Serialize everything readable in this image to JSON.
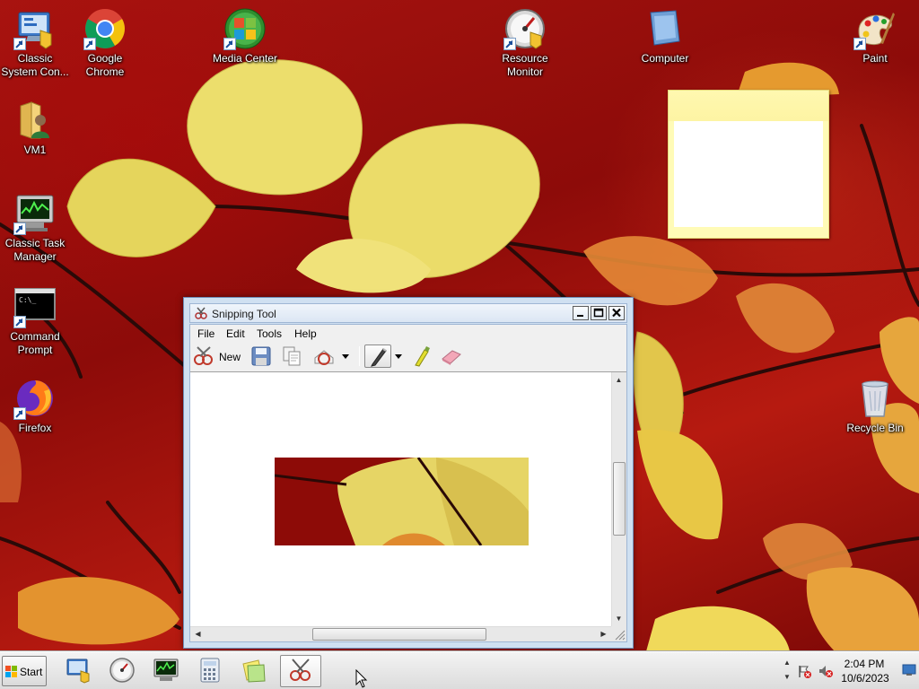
{
  "desktop": {
    "icons": [
      {
        "label": "Classic System Con...",
        "icon": "control-panel-icon"
      },
      {
        "label": "Google Chrome",
        "icon": "chrome-icon"
      },
      {
        "label": "Media Center",
        "icon": "media-center-icon"
      },
      {
        "label": "Resource Monitor",
        "icon": "resource-monitor-icon"
      },
      {
        "label": "Computer",
        "icon": "computer-icon"
      },
      {
        "label": "Paint",
        "icon": "paint-icon"
      },
      {
        "label": "VM1",
        "icon": "user-folder-icon"
      },
      {
        "label": "Classic Task Manager",
        "icon": "task-manager-icon"
      },
      {
        "label": "Command Prompt",
        "icon": "command-prompt-icon"
      },
      {
        "label": "Firefox",
        "icon": "firefox-icon"
      },
      {
        "label": "Recycle Bin",
        "icon": "recycle-bin-icon"
      }
    ]
  },
  "snipping_tool": {
    "title": "Snipping Tool",
    "menu": [
      "File",
      "Edit",
      "Tools",
      "Help"
    ],
    "toolbar": {
      "new_label": "New",
      "buttons": [
        "new-snip-icon",
        "save-icon",
        "copy-icon",
        "send-snip-icon",
        "pen-icon",
        "highlighter-icon",
        "eraser-icon"
      ]
    },
    "window_buttons": {
      "minimize": "_",
      "maximize": "□",
      "close": "✕"
    }
  },
  "taskbar": {
    "start_label": "Start",
    "pinned": [
      "control-panel-icon",
      "resource-monitor-icon",
      "task-manager-icon",
      "calculator-icon",
      "sticky-notes-icon",
      "snipping-tool-icon"
    ],
    "active": "snipping-tool-icon",
    "clock": {
      "time": "2:04 PM",
      "date": "10/6/2023"
    }
  },
  "colors": {
    "wallpaper_red": "#9b0f0a",
    "leaf_yellow": "#e8d760",
    "taskbar_bg": "#e6e6e6",
    "window_frame": "#cfe0f1"
  }
}
